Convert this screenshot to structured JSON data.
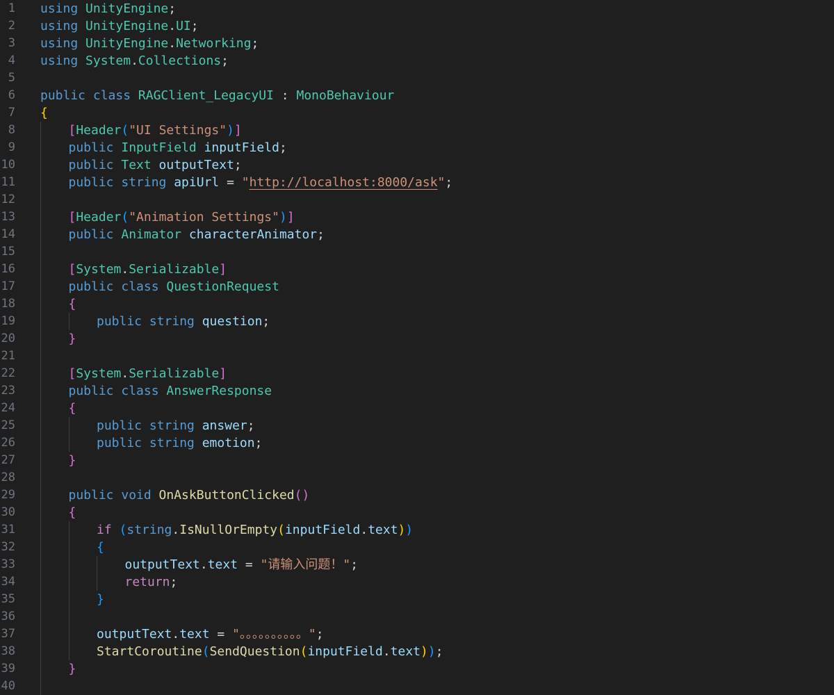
{
  "editor": {
    "colors": {
      "background": "#1f1f1f",
      "line_number": "#6e7681",
      "keyword": "#569cd6",
      "control_keyword": "#c586c0",
      "type": "#4ec9b0",
      "variable": "#9cdcfe",
      "string": "#ce9178",
      "method": "#dcdcaa",
      "plain": "#d4d4d4",
      "bracket_gold": "#ffd700",
      "bracket_purple": "#da70d6",
      "bracket_blue": "#179fff"
    },
    "lines": [
      {
        "n": "1",
        "indent": 0,
        "tokens": [
          [
            "using ",
            "#569cd6"
          ],
          [
            "UnityEngine",
            "#4ec9b0"
          ],
          [
            ";",
            "#d4d4d4"
          ]
        ]
      },
      {
        "n": "2",
        "indent": 0,
        "tokens": [
          [
            "using ",
            "#569cd6"
          ],
          [
            "UnityEngine",
            "#4ec9b0"
          ],
          [
            ".",
            "#d4d4d4"
          ],
          [
            "UI",
            "#4ec9b0"
          ],
          [
            ";",
            "#d4d4d4"
          ]
        ]
      },
      {
        "n": "3",
        "indent": 0,
        "tokens": [
          [
            "using ",
            "#569cd6"
          ],
          [
            "UnityEngine",
            "#4ec9b0"
          ],
          [
            ".",
            "#d4d4d4"
          ],
          [
            "Networking",
            "#4ec9b0"
          ],
          [
            ";",
            "#d4d4d4"
          ]
        ]
      },
      {
        "n": "4",
        "indent": 0,
        "tokens": [
          [
            "using ",
            "#569cd6"
          ],
          [
            "System",
            "#4ec9b0"
          ],
          [
            ".",
            "#d4d4d4"
          ],
          [
            "Collections",
            "#4ec9b0"
          ],
          [
            ";",
            "#d4d4d4"
          ]
        ]
      },
      {
        "n": "5",
        "indent": 0,
        "tokens": []
      },
      {
        "n": "6",
        "indent": 0,
        "tokens": [
          [
            "public ",
            "#569cd6"
          ],
          [
            "class ",
            "#569cd6"
          ],
          [
            "RAGClient_LegacyUI",
            "#4ec9b0"
          ],
          [
            " : ",
            "#d4d4d4"
          ],
          [
            "MonoBehaviour",
            "#4ec9b0"
          ]
        ]
      },
      {
        "n": "7",
        "indent": 0,
        "tokens": [
          [
            "{",
            "#ffd700"
          ]
        ]
      },
      {
        "n": "8",
        "indent": 1,
        "tokens": [
          [
            "[",
            "#da70d6"
          ],
          [
            "Header",
            "#4ec9b0"
          ],
          [
            "(",
            "#179fff"
          ],
          [
            "\"UI Settings\"",
            "#ce9178"
          ],
          [
            ")",
            "#179fff"
          ],
          [
            "]",
            "#da70d6"
          ]
        ]
      },
      {
        "n": "9",
        "indent": 1,
        "tokens": [
          [
            "public ",
            "#569cd6"
          ],
          [
            "InputField ",
            "#4ec9b0"
          ],
          [
            "inputField",
            "#9cdcfe"
          ],
          [
            ";",
            "#d4d4d4"
          ]
        ]
      },
      {
        "n": "10",
        "indent": 1,
        "tokens": [
          [
            "public ",
            "#569cd6"
          ],
          [
            "Text ",
            "#4ec9b0"
          ],
          [
            "outputText",
            "#9cdcfe"
          ],
          [
            ";",
            "#d4d4d4"
          ]
        ]
      },
      {
        "n": "11",
        "indent": 1,
        "tokens": [
          [
            "public ",
            "#569cd6"
          ],
          [
            "string ",
            "#569cd6"
          ],
          [
            "apiUrl",
            "#9cdcfe"
          ],
          [
            " = ",
            "#d4d4d4"
          ],
          [
            "\"",
            "#ce9178"
          ],
          [
            "http://localhost:8000/ask",
            "#ce9178",
            "url"
          ],
          [
            "\"",
            "#ce9178"
          ],
          [
            ";",
            "#d4d4d4"
          ]
        ]
      },
      {
        "n": "12",
        "indent": 1,
        "tokens": []
      },
      {
        "n": "13",
        "indent": 1,
        "tokens": [
          [
            "[",
            "#da70d6"
          ],
          [
            "Header",
            "#4ec9b0"
          ],
          [
            "(",
            "#179fff"
          ],
          [
            "\"Animation Settings\"",
            "#ce9178"
          ],
          [
            ")",
            "#179fff"
          ],
          [
            "]",
            "#da70d6"
          ]
        ]
      },
      {
        "n": "14",
        "indent": 1,
        "tokens": [
          [
            "public ",
            "#569cd6"
          ],
          [
            "Animator ",
            "#4ec9b0"
          ],
          [
            "characterAnimator",
            "#9cdcfe"
          ],
          [
            ";",
            "#d4d4d4"
          ]
        ]
      },
      {
        "n": "15",
        "indent": 1,
        "tokens": []
      },
      {
        "n": "16",
        "indent": 1,
        "tokens": [
          [
            "[",
            "#da70d6"
          ],
          [
            "System",
            "#4ec9b0"
          ],
          [
            ".",
            "#d4d4d4"
          ],
          [
            "Serializable",
            "#4ec9b0"
          ],
          [
            "]",
            "#da70d6"
          ]
        ]
      },
      {
        "n": "17",
        "indent": 1,
        "tokens": [
          [
            "public ",
            "#569cd6"
          ],
          [
            "class ",
            "#569cd6"
          ],
          [
            "QuestionRequest",
            "#4ec9b0"
          ]
        ]
      },
      {
        "n": "18",
        "indent": 1,
        "tokens": [
          [
            "{",
            "#da70d6"
          ]
        ]
      },
      {
        "n": "19",
        "indent": 2,
        "tokens": [
          [
            "public ",
            "#569cd6"
          ],
          [
            "string ",
            "#569cd6"
          ],
          [
            "question",
            "#9cdcfe"
          ],
          [
            ";",
            "#d4d4d4"
          ]
        ]
      },
      {
        "n": "20",
        "indent": 1,
        "tokens": [
          [
            "}",
            "#da70d6"
          ]
        ]
      },
      {
        "n": "21",
        "indent": 1,
        "tokens": []
      },
      {
        "n": "22",
        "indent": 1,
        "tokens": [
          [
            "[",
            "#da70d6"
          ],
          [
            "System",
            "#4ec9b0"
          ],
          [
            ".",
            "#d4d4d4"
          ],
          [
            "Serializable",
            "#4ec9b0"
          ],
          [
            "]",
            "#da70d6"
          ]
        ]
      },
      {
        "n": "23",
        "indent": 1,
        "tokens": [
          [
            "public ",
            "#569cd6"
          ],
          [
            "class ",
            "#569cd6"
          ],
          [
            "AnswerResponse",
            "#4ec9b0"
          ]
        ]
      },
      {
        "n": "24",
        "indent": 1,
        "tokens": [
          [
            "{",
            "#da70d6"
          ]
        ]
      },
      {
        "n": "25",
        "indent": 2,
        "tokens": [
          [
            "public ",
            "#569cd6"
          ],
          [
            "string ",
            "#569cd6"
          ],
          [
            "answer",
            "#9cdcfe"
          ],
          [
            ";",
            "#d4d4d4"
          ]
        ]
      },
      {
        "n": "26",
        "indent": 2,
        "tokens": [
          [
            "public ",
            "#569cd6"
          ],
          [
            "string ",
            "#569cd6"
          ],
          [
            "emotion",
            "#9cdcfe"
          ],
          [
            ";",
            "#d4d4d4"
          ]
        ]
      },
      {
        "n": "27",
        "indent": 1,
        "tokens": [
          [
            "}",
            "#da70d6"
          ]
        ]
      },
      {
        "n": "28",
        "indent": 1,
        "tokens": []
      },
      {
        "n": "29",
        "indent": 1,
        "tokens": [
          [
            "public ",
            "#569cd6"
          ],
          [
            "void ",
            "#569cd6"
          ],
          [
            "OnAskButtonClicked",
            "#dcdcaa"
          ],
          [
            "()",
            "#da70d6"
          ]
        ]
      },
      {
        "n": "30",
        "indent": 1,
        "tokens": [
          [
            "{",
            "#da70d6"
          ]
        ]
      },
      {
        "n": "31",
        "indent": 2,
        "tokens": [
          [
            "if ",
            "#c586c0"
          ],
          [
            "(",
            "#179fff"
          ],
          [
            "string",
            "#569cd6"
          ],
          [
            ".",
            "#d4d4d4"
          ],
          [
            "IsNullOrEmpty",
            "#dcdcaa"
          ],
          [
            "(",
            "#ffd700"
          ],
          [
            "inputField",
            "#9cdcfe"
          ],
          [
            ".",
            "#d4d4d4"
          ],
          [
            "text",
            "#9cdcfe"
          ],
          [
            ")",
            "#ffd700"
          ],
          [
            ")",
            "#179fff"
          ]
        ]
      },
      {
        "n": "32",
        "indent": 2,
        "tokens": [
          [
            "{",
            "#179fff"
          ]
        ]
      },
      {
        "n": "33",
        "indent": 3,
        "tokens": [
          [
            "outputText",
            "#9cdcfe"
          ],
          [
            ".",
            "#d4d4d4"
          ],
          [
            "text",
            "#9cdcfe"
          ],
          [
            " = ",
            "#d4d4d4"
          ],
          [
            "\"请输入问题！\"",
            "#ce9178"
          ],
          [
            ";",
            "#d4d4d4"
          ]
        ]
      },
      {
        "n": "34",
        "indent": 3,
        "tokens": [
          [
            "return",
            "#c586c0"
          ],
          [
            ";",
            "#d4d4d4"
          ]
        ]
      },
      {
        "n": "35",
        "indent": 2,
        "tokens": [
          [
            "}",
            "#179fff"
          ]
        ]
      },
      {
        "n": "36",
        "indent": 2,
        "tokens": []
      },
      {
        "n": "37",
        "indent": 2,
        "tokens": [
          [
            "outputText",
            "#9cdcfe"
          ],
          [
            ".",
            "#d4d4d4"
          ],
          [
            "text",
            "#9cdcfe"
          ],
          [
            " = ",
            "#d4d4d4"
          ],
          [
            "\"。。。。。。。。。。\"",
            "#ce9178"
          ],
          [
            ";",
            "#d4d4d4"
          ]
        ]
      },
      {
        "n": "38",
        "indent": 2,
        "tokens": [
          [
            "StartCoroutine",
            "#dcdcaa"
          ],
          [
            "(",
            "#179fff"
          ],
          [
            "SendQuestion",
            "#dcdcaa"
          ],
          [
            "(",
            "#ffd700"
          ],
          [
            "inputField",
            "#9cdcfe"
          ],
          [
            ".",
            "#d4d4d4"
          ],
          [
            "text",
            "#9cdcfe"
          ],
          [
            ")",
            "#ffd700"
          ],
          [
            ")",
            "#179fff"
          ],
          [
            ";",
            "#d4d4d4"
          ]
        ]
      },
      {
        "n": "39",
        "indent": 1,
        "tokens": [
          [
            "}",
            "#da70d6"
          ]
        ]
      },
      {
        "n": "40",
        "indent": 1,
        "tokens": []
      }
    ]
  }
}
